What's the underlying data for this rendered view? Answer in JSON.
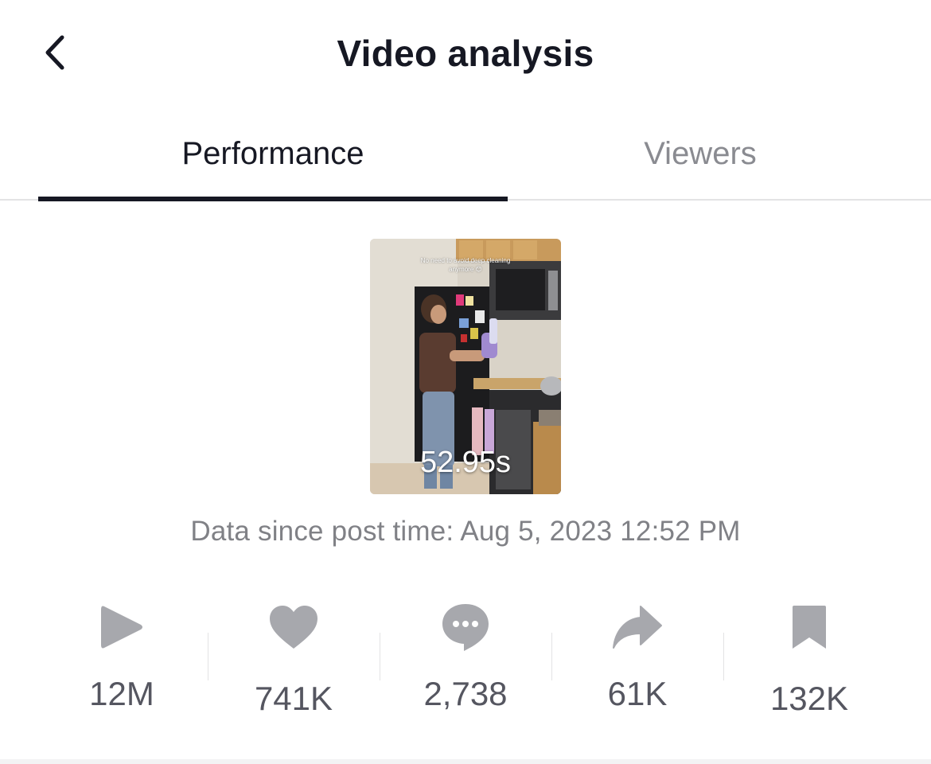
{
  "header": {
    "title": "Video analysis",
    "back_icon": "chevron-left-icon"
  },
  "tabs": [
    {
      "label": "Performance",
      "active": true
    },
    {
      "label": "Viewers",
      "active": false
    }
  ],
  "video": {
    "duration": "52.95s",
    "overlay_caption": "No need to avoid deep cleaning anymore 😊"
  },
  "since_text": "Data since post time: Aug 5, 2023 12:52 PM",
  "stats": [
    {
      "icon": "play-icon",
      "value": "12M"
    },
    {
      "icon": "heart-icon",
      "value": "741K"
    },
    {
      "icon": "comment-icon",
      "value": "2,738"
    },
    {
      "icon": "share-icon",
      "value": "61K"
    },
    {
      "icon": "bookmark-icon",
      "value": "132K"
    }
  ],
  "colors": {
    "text_primary": "#161823",
    "text_secondary": "#808186",
    "tab_inactive": "#8a8b91",
    "icon_gray": "#a7a8ad",
    "stat_value": "#555660",
    "divider": "#e3e3e4"
  }
}
